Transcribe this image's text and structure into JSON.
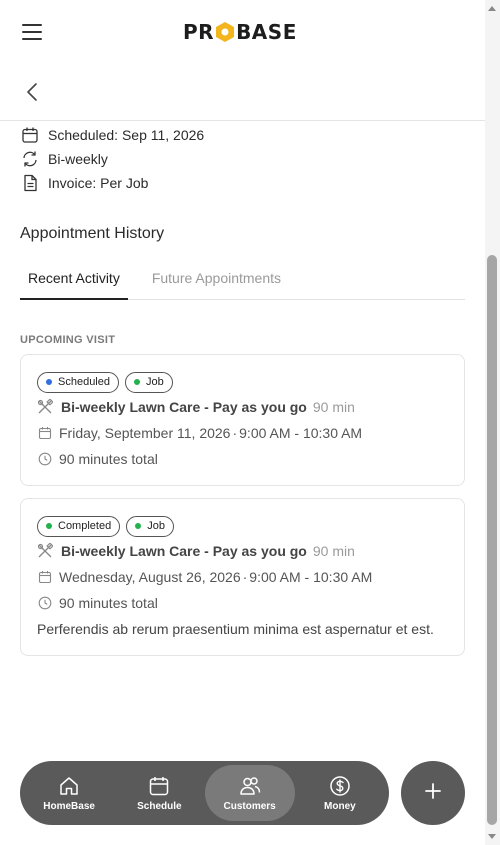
{
  "header": {
    "logo_text": "PROBASE",
    "menu_icon": "hamburger-menu-icon",
    "back_icon": "chevron-left-icon"
  },
  "details": {
    "scheduled": "Scheduled: Sep 11, 2026",
    "frequency": "Bi-weekly",
    "invoice": "Invoice: Per Job"
  },
  "history": {
    "title": "Appointment History",
    "tabs": [
      {
        "label": "Recent Activity",
        "active": true
      },
      {
        "label": "Future Appointments",
        "active": false
      }
    ],
    "upcoming_label": "UPCOMING VISIT",
    "visits": [
      {
        "status": "Scheduled",
        "status_color": "#2f6fe0",
        "type": "Job",
        "type_color": "#22b24c",
        "service": "Bi-weekly Lawn Care - Pay as you go",
        "duration": "90 min",
        "date": "Friday, September 11, 2026",
        "time": "9:00 AM - 10:30 AM",
        "total": "90 minutes total",
        "note": ""
      },
      {
        "status": "Completed",
        "status_color": "#22b24c",
        "type": "Job",
        "type_color": "#22b24c",
        "service": "Bi-weekly Lawn Care - Pay as you go",
        "duration": "90 min",
        "date": "Wednesday, August 26, 2026",
        "time": "9:00 AM - 10:30 AM",
        "total": "90 minutes total",
        "note": "Perferendis ab rerum praesentium minima est aspernatur et est."
      }
    ]
  },
  "nav": {
    "items": [
      {
        "label": "HomeBase",
        "icon": "home-icon",
        "active": false
      },
      {
        "label": "Schedule",
        "icon": "calendar-icon",
        "active": false
      },
      {
        "label": "Customers",
        "icon": "users-icon",
        "active": true
      },
      {
        "label": "Money",
        "icon": "dollar-icon",
        "active": false
      }
    ],
    "fab_icon": "plus-icon"
  },
  "colors": {
    "logo_accent": "#f2b51d",
    "nav_bg": "#5a5a5a",
    "nav_active_bg": "#7a7a7a"
  }
}
